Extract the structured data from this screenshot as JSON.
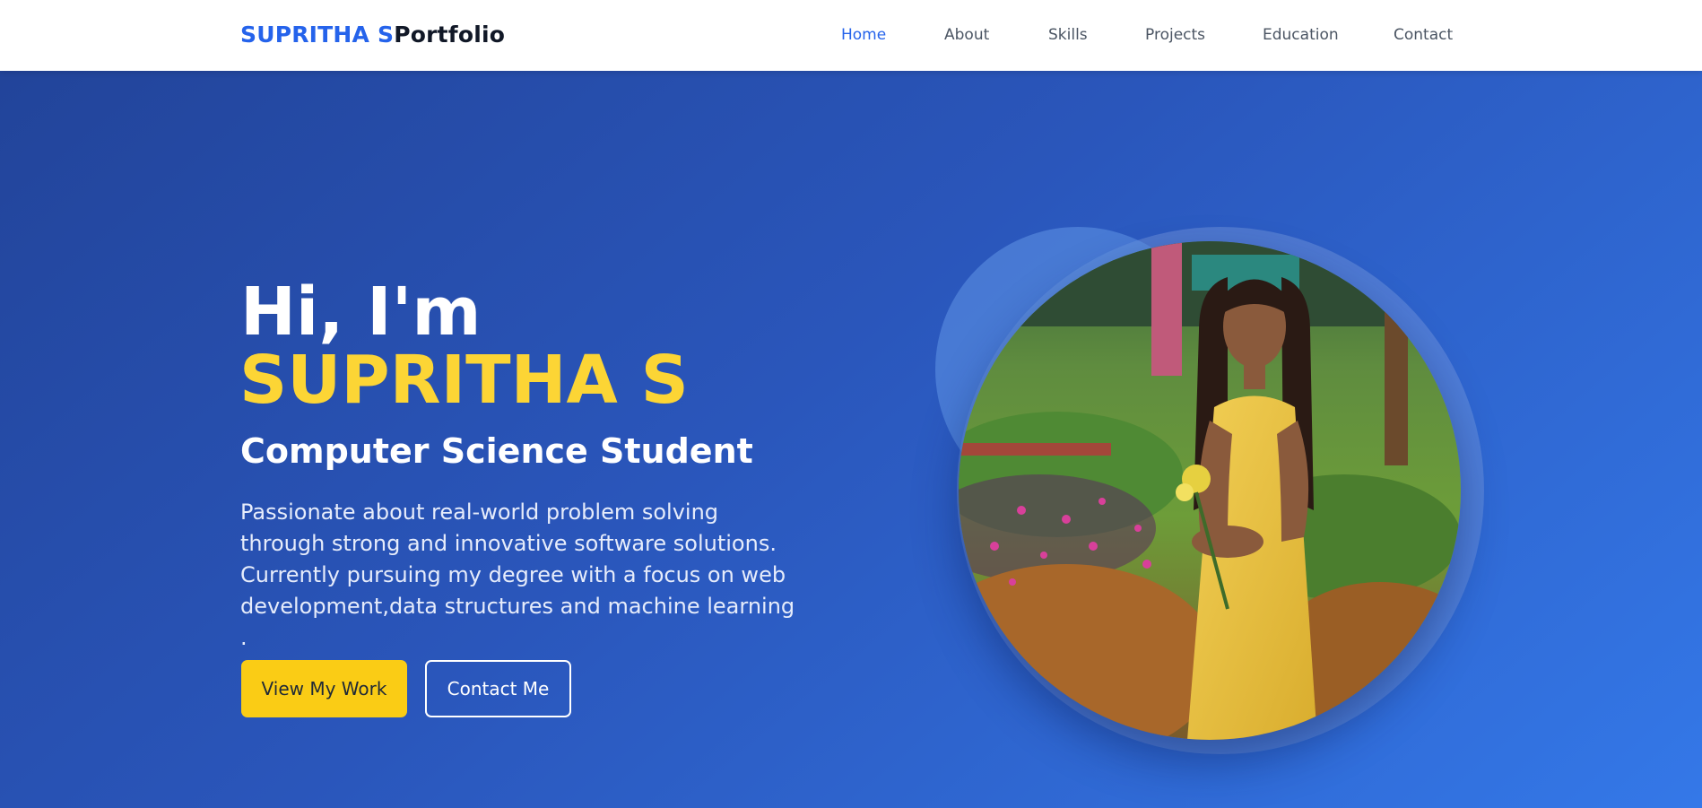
{
  "header": {
    "brand_accent": "SUPRITHA S",
    "brand_rest": "Portfolio",
    "nav": [
      {
        "label": "Home",
        "active": true
      },
      {
        "label": "About"
      },
      {
        "label": "Skills"
      },
      {
        "label": "Projects"
      },
      {
        "label": "Education"
      },
      {
        "label": "Contact"
      }
    ]
  },
  "hero": {
    "greeting": "Hi, I'm",
    "name": "SUPRITHA S",
    "role": "Computer Science Student",
    "description": "Passionate about real-world problem solving through strong and innovative software solutions. Currently pursuing my degree with a focus on web development,data structures and machine learning .",
    "primary_button": "View My Work",
    "secondary_button": "Contact Me",
    "portrait_alt": "profile photo"
  },
  "colors": {
    "accent": "#2563eb",
    "highlight": "#fcd535",
    "button_yellow": "#facc15",
    "hero_gradient_start": "#22449a",
    "hero_gradient_end": "#3478e8"
  }
}
